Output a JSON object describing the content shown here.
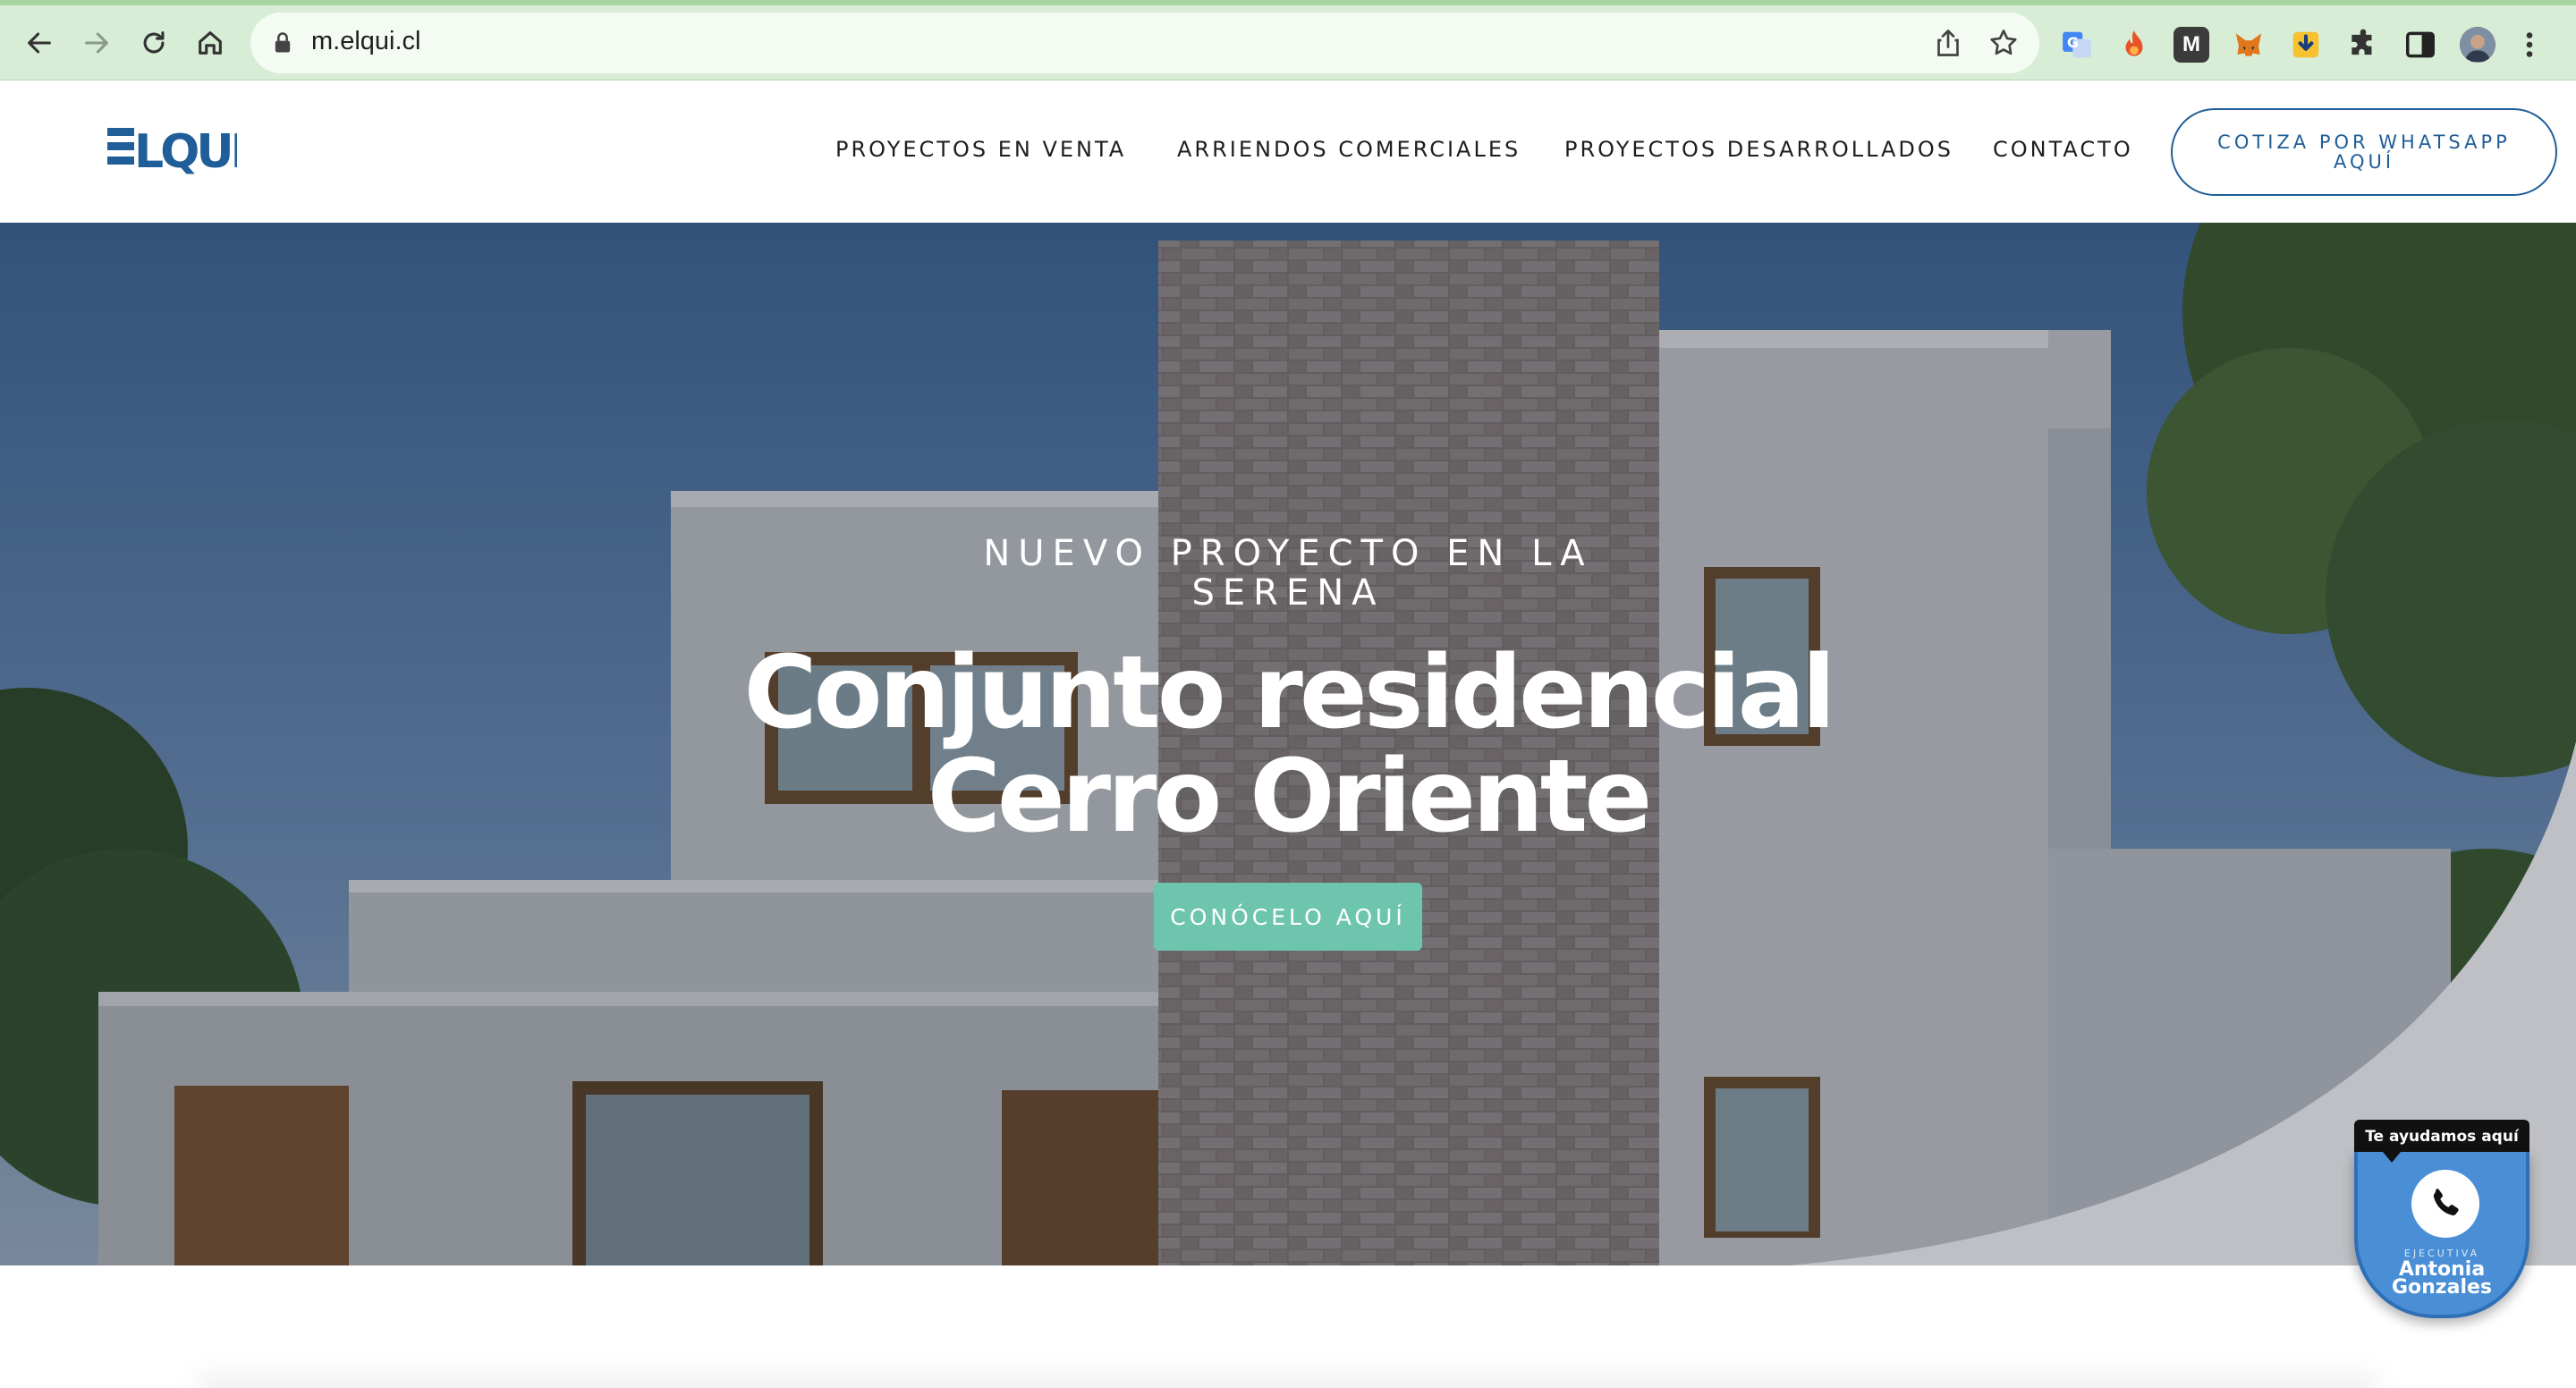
{
  "browser": {
    "url": "m.elqui.cl",
    "buttons": {
      "back": "back-icon",
      "forward": "forward-icon",
      "reload": "reload-icon",
      "home": "home-icon"
    },
    "extensions": [
      "google-translate-icon",
      "flame-extension-icon",
      "m-extension-icon",
      "metamask-fox-icon",
      "download-extension-icon",
      "puzzle-extensions-icon",
      "side-panel-icon",
      "profile-avatar",
      "kebab-menu-icon"
    ]
  },
  "site": {
    "logo_text": "ELQUI",
    "nav": {
      "proyectos_venta": "PROYECTOS EN VENTA",
      "arriendos": "ARRIENDOS COMERCIALES",
      "desarrollados": "PROYECTOS DESARROLLADOS",
      "contacto": "CONTACTO"
    },
    "cta": "COTIZA POR WHATSAPP AQUÍ"
  },
  "hero": {
    "eyebrow": "NUEVO PROYECTO EN LA SERENA",
    "title": "Conjunto residencial Cerro Oriente",
    "button": "CONÓCELO AQUÍ"
  },
  "whatsapp_widget": {
    "tag": "Te ayudamos aquí",
    "role": "EJECUTIVA",
    "name": "Antonia Gonzales"
  },
  "colors": {
    "brand_blue": "#1f5e98",
    "accent_teal": "#6ec5ad",
    "chrome_green": "#d8edd6",
    "widget_blue": "#4a8fd6"
  }
}
